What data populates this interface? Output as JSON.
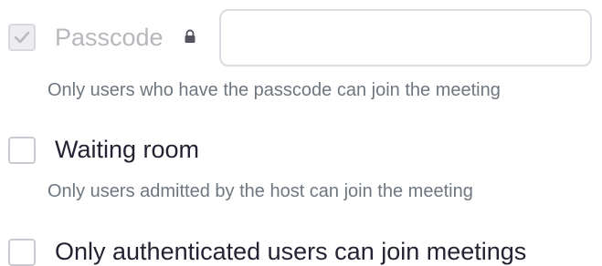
{
  "passcode": {
    "label": "Passcode",
    "checked": true,
    "disabled": true,
    "input_value": "",
    "lock_icon": "lock-icon",
    "description": "Only users who have the passcode can join the meeting"
  },
  "waiting_room": {
    "label": "Waiting room",
    "checked": false,
    "description": "Only users admitted by the host can join the meeting"
  },
  "authenticated": {
    "label": "Only authenticated users can join meetings",
    "checked": false
  },
  "colors": {
    "text": "#232333",
    "disabled_text": "#b7b7bd",
    "description_text": "#6e7680",
    "checkbox_border": "#c9c9d1",
    "disabled_checkbox_bg": "#ededf0",
    "checkmark": "#b9b9c0"
  }
}
